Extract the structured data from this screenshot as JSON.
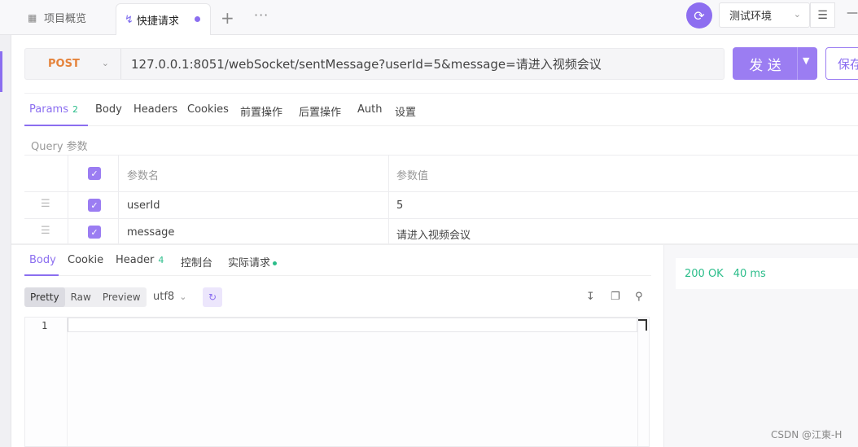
{
  "tabs": {
    "overview": "项目概览",
    "active": "快捷请求"
  },
  "toolbar": {
    "environment": "测试环境"
  },
  "request": {
    "method": "POST",
    "url": "127.0.0.1:8051/webSocket/sentMessage?userId=5&message=请进入视频会议",
    "send_label": "发 送",
    "save_label": "保存"
  },
  "request_tabs": {
    "params": "Params",
    "params_count": "2",
    "body": "Body",
    "headers": "Headers",
    "cookies": "Cookies",
    "pre": "前置操作",
    "post": "后置操作",
    "auth": "Auth",
    "settings": "设置"
  },
  "query": {
    "label": "Query 参数",
    "col_name": "参数名",
    "col_value": "参数值",
    "rows": [
      {
        "name": "userId",
        "value": "5"
      },
      {
        "name": "message",
        "value": "请进入视频会议"
      }
    ]
  },
  "response_tabs": {
    "body": "Body",
    "cookie": "Cookie",
    "header": "Header",
    "header_count": "4",
    "console": "控制台",
    "actual": "实际请求"
  },
  "format": {
    "pretty": "Pretty",
    "raw": "Raw",
    "preview": "Preview",
    "encoding": "utf8"
  },
  "editor": {
    "line1": "1"
  },
  "status": {
    "code": "200 OK",
    "time": "40 ms"
  },
  "watermark": "CSDN @江東-H",
  "colors": {
    "accent": "#8b6ef0",
    "method": "#e5833b",
    "success": "#2bbd8a"
  }
}
